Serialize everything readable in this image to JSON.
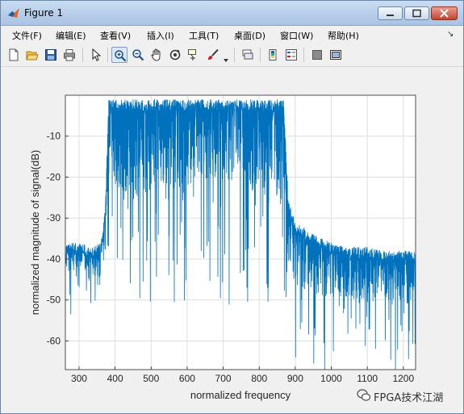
{
  "window": {
    "title": "Figure 1"
  },
  "menus": [
    "文件(F)",
    "编辑(E)",
    "查看(V)",
    "插入(I)",
    "工具(T)",
    "桌面(D)",
    "窗口(W)",
    "帮助(H)"
  ],
  "toolbar": {
    "icons": [
      "new-figure-icon",
      "open-file-icon",
      "save-icon",
      "print-icon",
      "pointer-icon",
      "zoom-in-icon",
      "zoom-out-icon",
      "pan-icon",
      "rotate-3d-icon",
      "data-cursor-icon",
      "brush-icon",
      "brush-dropdown-icon",
      "link-plot-icon",
      "colorbar-icon",
      "legend-icon",
      "hide-plot-tools-icon",
      "show-plot-tools-icon"
    ],
    "active": "zoom-in-icon"
  },
  "chart_data": {
    "type": "line",
    "xlabel": "normalized frequency",
    "ylabel": "normalized magnitude of signal(dB)",
    "xlim": [
      262,
      1234
    ],
    "ylim": [
      -67,
      0
    ],
    "xticks": [
      300,
      400,
      500,
      600,
      700,
      800,
      900,
      1000,
      1100,
      1200
    ],
    "yticks": [
      -10,
      -20,
      -30,
      -40,
      -50,
      -60
    ],
    "grid": true,
    "series_color": "#0072bd",
    "envelope": {
      "x": [
        262,
        300,
        340,
        360,
        372,
        382,
        400,
        450,
        500,
        550,
        600,
        650,
        700,
        750,
        800,
        850,
        868,
        880,
        900,
        950,
        1000,
        1050,
        1100,
        1150,
        1200,
        1234
      ],
      "upper_db": [
        -36,
        -36,
        -37,
        -36,
        -28,
        -1,
        -1,
        -1,
        -1,
        -1,
        -1,
        -1,
        -1,
        -1,
        -1,
        -1,
        -1,
        -25,
        -31,
        -34,
        -36,
        -37,
        -37,
        -38,
        -38,
        -38
      ],
      "band_db": [
        -43,
        -42,
        -43,
        -42,
        -40,
        -12,
        -22,
        -24,
        -24,
        -22,
        -21,
        -20,
        -20,
        -20,
        -22,
        -24,
        -28,
        -40,
        -46,
        -48,
        -49,
        -49,
        -50,
        -50,
        -50,
        -51
      ],
      "lower_db": [
        -52,
        -50,
        -51,
        -50,
        -48,
        -30,
        -40,
        -44,
        -46,
        -46,
        -44,
        -44,
        -45,
        -46,
        -48,
        -48,
        -50,
        -55,
        -60,
        -62,
        -64,
        -64,
        -64,
        -65,
        -65,
        -66
      ]
    }
  },
  "watermark": {
    "text": "FPGA技术江湖"
  }
}
